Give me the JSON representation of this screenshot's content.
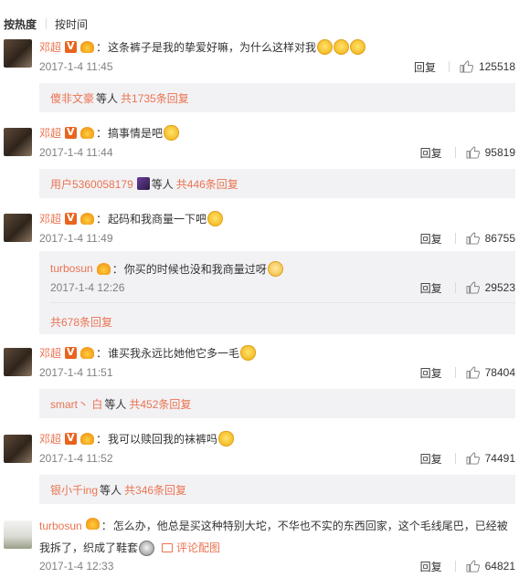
{
  "tabs": {
    "hot": "按热度",
    "time": "按时间"
  },
  "actions": {
    "reply": "回复"
  },
  "comments": [
    {
      "user": "邓超",
      "colon": "：",
      "text": "这条裤子是我的挚爱好嘛，为什么这样对我",
      "time": "2017-1-4 11:45",
      "likes": "125518",
      "sub": {
        "name": "傻非文豪",
        "mid": "等人",
        "count": "共1735条回复"
      }
    },
    {
      "user": "邓超",
      "colon": "：",
      "text": "搞事情是吧",
      "time": "2017-1-4 11:44",
      "likes": "95819",
      "sub": {
        "name": "用户5360058179",
        "mid": "等人",
        "count": "共446条回复"
      }
    },
    {
      "user": "邓超",
      "colon": "：",
      "text": "起码和我商量一下吧",
      "time": "2017-1-4 11:49",
      "likes": "86755",
      "nested": {
        "user": "turbosun",
        "colon": "：",
        "text": "你买的时候也没和我商量过呀",
        "time": "2017-1-4 12:26",
        "likes": "29523",
        "more": "共678条回复"
      }
    },
    {
      "user": "邓超",
      "colon": "：",
      "text": "谁买我永远比她他它多一毛",
      "time": "2017-1-4 11:51",
      "likes": "78404",
      "sub": {
        "name": "smart丶 白",
        "mid": "等人",
        "count": "共452条回复"
      }
    },
    {
      "user": "邓超",
      "colon": "：",
      "text": "我可以赎回我的袜裤吗",
      "time": "2017-1-4 11:52",
      "likes": "74491",
      "sub": {
        "name": "银小千ing",
        "mid": "等人",
        "count": "共346条回复"
      }
    },
    {
      "user": "turbosun",
      "colon": "：",
      "text_line1": "怎么办，他总是买这种特别大坨，不华也不实的东西回家，这个毛线尾巴，已经被",
      "text_line2": "我拆了，织成了鞋套",
      "pic_link": "评论配图",
      "time": "2017-1-4 12:33",
      "likes": "64821"
    }
  ],
  "colors": {
    "accent": "#eb7350",
    "sub_bg": "#f2f2f5",
    "meta": "#808080"
  }
}
